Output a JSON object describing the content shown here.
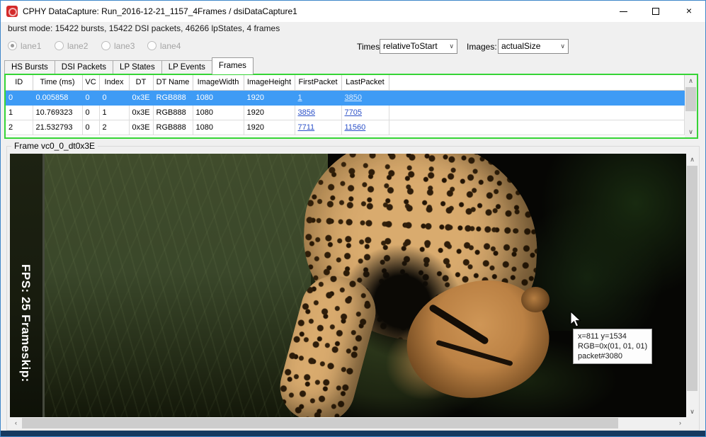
{
  "window": {
    "title": "CPHY DataCapture: Run_2016-12-21_1157_4Frames / dsiDataCapture1"
  },
  "icons": {
    "close": "×",
    "scroll_up": "∧",
    "scroll_down": "∨",
    "scroll_left": "‹",
    "scroll_right": "›",
    "combo_chevron": "∨"
  },
  "status": {
    "text": "burst mode: 15422 bursts, 15422 DSI packets, 46266 lpStates, 4 frames"
  },
  "lanes": {
    "items": [
      {
        "label": "lane1",
        "selected": true
      },
      {
        "label": "lane2",
        "selected": false
      },
      {
        "label": "lane3",
        "selected": false
      },
      {
        "label": "lane4",
        "selected": false
      }
    ]
  },
  "selectors": {
    "times_label": "Times:",
    "times_value": "relativeToStart",
    "images_label": "Images:",
    "images_value": "actualSize"
  },
  "tabs": {
    "items": [
      {
        "label": "HS Bursts",
        "active": false
      },
      {
        "label": "DSI Packets",
        "active": false
      },
      {
        "label": "LP States",
        "active": false
      },
      {
        "label": "LP Events",
        "active": false
      },
      {
        "label": "Frames",
        "active": true
      }
    ]
  },
  "table": {
    "columns": [
      "ID",
      "Time (ms)",
      "VC",
      "Index",
      "DT",
      "DT Name",
      "ImageWidth",
      "ImageHeight",
      "FirstPacket",
      "LastPacket"
    ],
    "rows": [
      {
        "id": "0",
        "time_ms": "0.005858",
        "vc": "0",
        "index": "0",
        "dt": "0x3E",
        "dt_name": "RGB888",
        "image_width": "1080",
        "image_height": "1920",
        "first_packet": "1",
        "last_packet": "3850",
        "selected": true
      },
      {
        "id": "1",
        "time_ms": "10.769323",
        "vc": "0",
        "index": "1",
        "dt": "0x3E",
        "dt_name": "RGB888",
        "image_width": "1080",
        "image_height": "1920",
        "first_packet": "3856",
        "last_packet": "7705",
        "selected": false
      },
      {
        "id": "2",
        "time_ms": "21.532793",
        "vc": "0",
        "index": "2",
        "dt": "0x3E",
        "dt_name": "RGB888",
        "image_width": "1080",
        "image_height": "1920",
        "first_packet": "7711",
        "last_packet": "11560",
        "selected": false
      }
    ]
  },
  "frame_panel": {
    "label": "Frame vc0_0_dt0x3E",
    "overlay_text": "FPS: 25   Frameskip:",
    "tooltip": {
      "line1": "x=811 y=1534",
      "line2": "RGB=0x(01, 01, 01)",
      "line3": "packet#3080"
    }
  },
  "colors": {
    "selection_blue": "#3e9bf5",
    "table_border_green": "#36d436",
    "link_blue": "#2b50c8",
    "window_border_blue": "#3f87c9"
  }
}
